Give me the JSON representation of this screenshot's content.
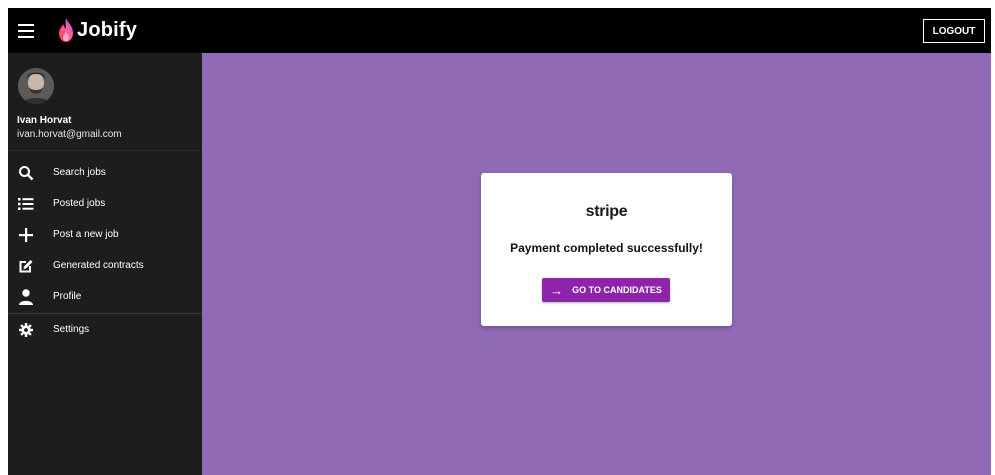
{
  "app": {
    "name": "Jobify",
    "logout_label": "LOGOUT"
  },
  "user": {
    "name": "Ivan Horvat",
    "email": "ivan.horvat@gmail.com"
  },
  "sidebar": {
    "items": [
      {
        "label": "Search jobs",
        "icon": "search-icon"
      },
      {
        "label": "Posted jobs",
        "icon": "list-icon"
      },
      {
        "label": "Post a new job",
        "icon": "plus-icon"
      },
      {
        "label": "Generated contracts",
        "icon": "edit-icon"
      },
      {
        "label": "Profile",
        "icon": "person-icon"
      },
      {
        "label": "Settings",
        "icon": "gear-icon"
      }
    ]
  },
  "payment": {
    "provider_logo": "stripe",
    "message": "Payment completed successfully!",
    "button_label": "GO TO CANDIDATES"
  },
  "colors": {
    "topbar": "#000000",
    "sidebar": "#1d1d1d",
    "main_background": "#916ab6",
    "accent": "#8e24aa"
  }
}
